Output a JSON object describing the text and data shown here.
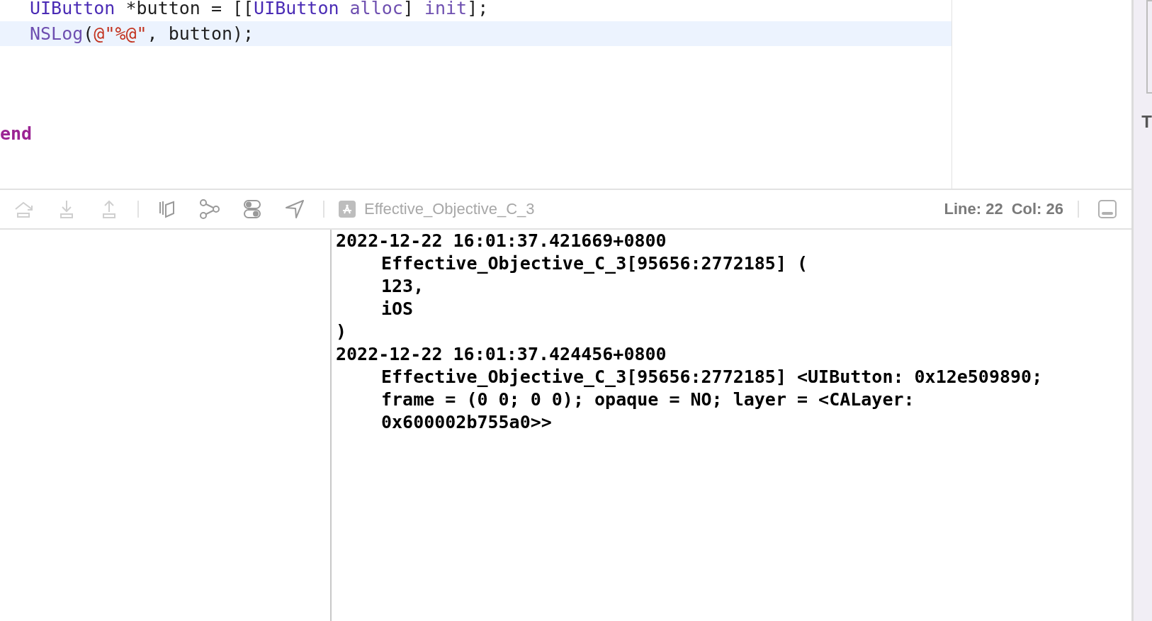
{
  "editor": {
    "lines": [
      {
        "selected": false,
        "tokens": [
          {
            "text": "UIButton",
            "kind": "type"
          },
          {
            "text": " *button = [[",
            "kind": "plain"
          },
          {
            "text": "UIButton",
            "kind": "type"
          },
          {
            "text": " alloc",
            "kind": "method"
          },
          {
            "text": "] ",
            "kind": "plain"
          },
          {
            "text": "init",
            "kind": "method"
          },
          {
            "text": "];",
            "kind": "plain"
          }
        ]
      },
      {
        "selected": true,
        "tokens": [
          {
            "text": "NSLog",
            "kind": "method"
          },
          {
            "text": "(",
            "kind": "plain"
          },
          {
            "text": "@\"%@\"",
            "kind": "string"
          },
          {
            "text": ", button);",
            "kind": "plain"
          }
        ]
      },
      {
        "selected": false,
        "outdent": true,
        "tokens": [
          {
            "text": "end",
            "kind": "keyword"
          }
        ]
      }
    ]
  },
  "toolbar": {
    "buttons": [
      {
        "kind": "step-out",
        "disabled": true
      },
      {
        "kind": "step-into",
        "disabled": true
      },
      {
        "kind": "step-up",
        "disabled": true
      },
      {
        "kind": "layers",
        "disabled": false
      },
      {
        "kind": "graph",
        "disabled": false
      },
      {
        "kind": "toggles",
        "disabled": false
      },
      {
        "kind": "location",
        "disabled": false
      }
    ],
    "scheme": "Effective_Objective_C_3",
    "line": "Line: 22",
    "col": "Col: 26"
  },
  "console": {
    "lines": [
      {
        "text": "2022-12-22 16:01:37.421669+0800",
        "indent": false
      },
      {
        "text": "Effective_Objective_C_3[95656:2772185] (",
        "indent": true
      },
      {
        "text": "123,",
        "indent": true
      },
      {
        "text": "iOS",
        "indent": true
      },
      {
        "text": ")",
        "indent": false
      },
      {
        "text": "2022-12-22 16:01:37.424456+0800",
        "indent": false
      },
      {
        "text": "Effective_Objective_C_3[95656:2772185] <UIButton: 0x12e509890;",
        "indent": true
      },
      {
        "text": "frame = (0 0; 0 0); opaque = NO; layer = <CALayer:",
        "indent": true
      },
      {
        "text": "0x600002b755a0>>",
        "indent": true
      }
    ]
  },
  "inspector": {
    "label": "T"
  }
}
